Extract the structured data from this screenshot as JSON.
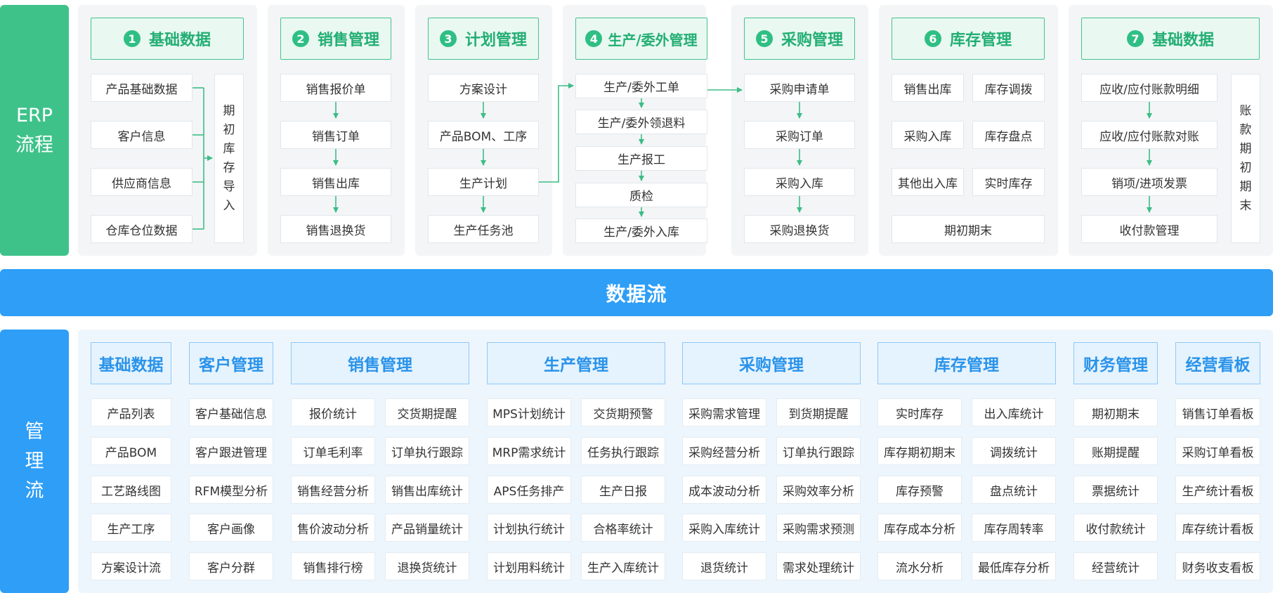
{
  "side_labels": {
    "erp": "ERP流程",
    "management": "管理流"
  },
  "banner": "数据流",
  "erp": {
    "basic": {
      "num": "1",
      "title": "基础数据",
      "items": [
        "产品基础数据",
        "客户信息",
        "供应商信息",
        "仓库仓位数据"
      ],
      "target": "期初库存导入"
    },
    "sales": {
      "num": "2",
      "title": "销售管理",
      "items": [
        "销售报价单",
        "销售订单",
        "销售出库",
        "销售退换货"
      ]
    },
    "plan": {
      "num": "3",
      "title": "计划管理",
      "items": [
        "方案设计",
        "产品BOM、工序",
        "生产计划",
        "生产任务池"
      ]
    },
    "production": {
      "num": "4",
      "title": "生产/委外管理",
      "items": [
        "生产/委外工单",
        "生产/委外领退料",
        "生产报工",
        "质检",
        "生产/委外入库"
      ]
    },
    "purchase": {
      "num": "5",
      "title": "采购管理",
      "items": [
        "采购申请单",
        "采购订单",
        "采购入库",
        "采购退换货"
      ]
    },
    "inventory": {
      "num": "6",
      "title": "库存管理",
      "items": [
        "销售出库",
        "库存调拨",
        "采购入库",
        "库存盘点",
        "其他出入库",
        "实时库存"
      ],
      "bottom": "期初期末"
    },
    "finance": {
      "num": "7",
      "title": "基础数据",
      "items": [
        "应收/应付账款明细",
        "应收/应付账款对账",
        "销项/进项发票",
        "收付款管理"
      ],
      "side": "账款期初期末"
    }
  },
  "management": {
    "basic": {
      "title": "基础数据",
      "items": [
        "产品列表",
        "产品BOM",
        "工艺路线图",
        "生产工序",
        "方案设计流"
      ]
    },
    "customer": {
      "title": "客户管理",
      "items": [
        "客户基础信息",
        "客户跟进管理",
        "RFM模型分析",
        "客户画像",
        "客户分群"
      ]
    },
    "sales": {
      "title": "销售管理",
      "items": [
        "报价统计",
        "交货期提醒",
        "订单毛利率",
        "订单执行跟踪",
        "销售经营分析",
        "销售出库统计",
        "售价波动分析",
        "产品销量统计",
        "销售排行榜",
        "退换货统计"
      ]
    },
    "production": {
      "title": "生产管理",
      "items": [
        "MPS计划统计",
        "交货期预警",
        "MRP需求统计",
        "任务执行跟踪",
        "APS任务排产",
        "生产日报",
        "计划执行统计",
        "合格率统计",
        "计划用料统计",
        "生产入库统计"
      ]
    },
    "purchase": {
      "title": "采购管理",
      "items": [
        "采购需求管理",
        "到货期提醒",
        "采购经营分析",
        "订单执行跟踪",
        "成本波动分析",
        "采购效率分析",
        "采购入库统计",
        "采购需求预测",
        "退货统计",
        "需求处理统计"
      ]
    },
    "inventory": {
      "title": "库存管理",
      "items": [
        "实时库存",
        "出入库统计",
        "库存期初期末",
        "调拨统计",
        "库存预警",
        "盘点统计",
        "库存成本分析",
        "库存周转率",
        "流水分析",
        "最低库存分析"
      ]
    },
    "finance": {
      "title": "财务管理",
      "items": [
        "期初期末",
        "账期提醒",
        "票据统计",
        "收付款统计",
        "经营统计"
      ]
    },
    "dashboard": {
      "title": "经营看板",
      "items": [
        "销售订单看板",
        "采购订单看板",
        "生产统计看板",
        "库存统计看板",
        "财务收支看板"
      ]
    }
  },
  "colors": {
    "erp_green": "#3ec28a",
    "flow_blue": "#2e9ef7",
    "arrow_green": "#3dbd86"
  }
}
